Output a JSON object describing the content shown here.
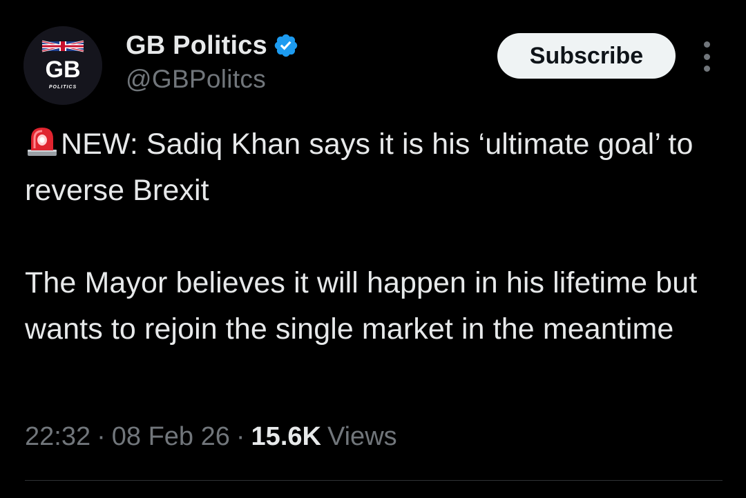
{
  "author": {
    "display_name": "GB Politics",
    "handle": "@GBPolitcs",
    "verified": true,
    "avatar": {
      "logo_text": "GB",
      "logo_subtext": "POLITICS"
    }
  },
  "actions": {
    "subscribe_label": "Subscribe",
    "more_icon": "more-dots-icon"
  },
  "tweet": {
    "alert_icon": "rotating-light-siren-emoji",
    "line1": "NEW: Sadiq Khan says it is his ‘ultimate goal’ to reverse Brexit",
    "paragraph2": "The Mayor believes it will happen in his lifetime but wants to rejoin the single market in the meantime"
  },
  "meta": {
    "time": "22:32",
    "separator": "·",
    "date": "08 Feb 26",
    "views_count": "15.6K",
    "views_label": "Views"
  },
  "colors": {
    "background": "#000000",
    "primary_text": "#e7e9ea",
    "secondary_text": "#71767b",
    "verified_blue": "#1d9bf0",
    "subscribe_bg": "#eff3f4",
    "divider": "#2f3336"
  }
}
